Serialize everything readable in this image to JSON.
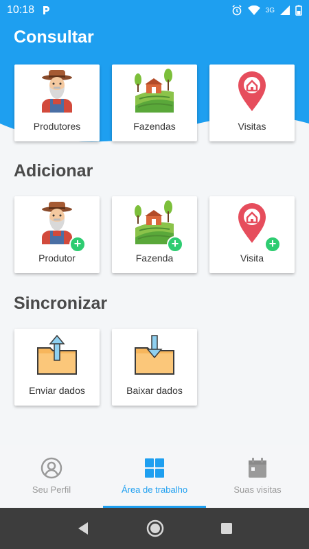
{
  "status_bar": {
    "time": "10:18",
    "network": "3G"
  },
  "colors": {
    "primary": "#1e9ff0",
    "text_dark": "#4a4a4a",
    "plus": "#2ecc71"
  },
  "sections": {
    "consultar": {
      "title": "Consultar",
      "cards": [
        {
          "label": "Produtores",
          "icon": "farmer-icon"
        },
        {
          "label": "Fazendas",
          "icon": "farm-icon"
        },
        {
          "label": "Visitas",
          "icon": "location-pin-icon"
        }
      ]
    },
    "adicionar": {
      "title": "Adicionar",
      "cards": [
        {
          "label": "Produtor",
          "icon": "farmer-icon"
        },
        {
          "label": "Fazenda",
          "icon": "farm-icon"
        },
        {
          "label": "Visita",
          "icon": "location-pin-icon"
        }
      ],
      "plus": "+"
    },
    "sincronizar": {
      "title": "Sincronizar",
      "cards": [
        {
          "label": "Enviar dados",
          "icon": "folder-upload-icon"
        },
        {
          "label": "Baixar dados",
          "icon": "folder-download-icon"
        }
      ]
    }
  },
  "bottom_nav": [
    {
      "label": "Seu Perfil",
      "icon": "user-circle-icon",
      "active": false
    },
    {
      "label": "Área de trabalho",
      "icon": "grid-icon",
      "active": true
    },
    {
      "label": "Suas visitas",
      "icon": "calendar-icon",
      "active": false
    }
  ]
}
